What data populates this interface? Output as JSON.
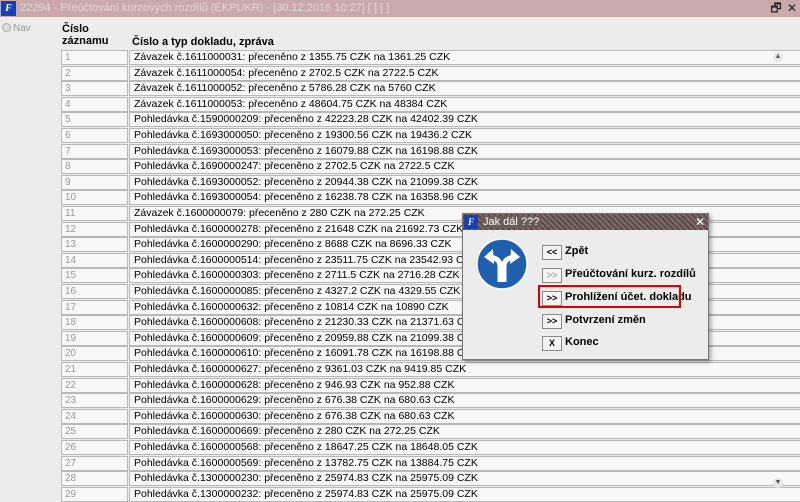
{
  "window": {
    "title": "22294 - Přeúčtování kurzových rozdílů (EKPUKR) - [30.12.2016 10:27] [ ] [ ]",
    "app_icon": "F",
    "restore_label": "🗗",
    "close_label": "✕"
  },
  "nav": {
    "label": "Nav"
  },
  "table": {
    "col1_header_line1": "Číslo",
    "col1_header_line2": "záznamu",
    "col2_header": "Číslo a typ dokladu, zpráva",
    "rows": [
      {
        "no": "1",
        "msg": "Závazek č.1611000031: přeceněno z 1355.75 CZK na 1361.25 CZK"
      },
      {
        "no": "2",
        "msg": "Závazek č.1611000054: přeceněno z 2702.5 CZK na 2722.5 CZK"
      },
      {
        "no": "3",
        "msg": "Závazek č.1611000052: přeceněno z 5786.28 CZK na 5760 CZK"
      },
      {
        "no": "4",
        "msg": "Závazek č.1611000053: přeceněno z 48604.75 CZK na 48384 CZK"
      },
      {
        "no": "5",
        "msg": "Pohledávka č.1590000209: přeceněno z 42223.28 CZK na 42402.39 CZK"
      },
      {
        "no": "6",
        "msg": "Pohledávka č.1693000050: přeceněno z 19300.56 CZK na 19436.2 CZK"
      },
      {
        "no": "7",
        "msg": "Pohledávka č.1693000053: přeceněno z 16079.88 CZK na 16198.88 CZK"
      },
      {
        "no": "8",
        "msg": "Pohledávka č.1690000247: přeceněno z 2702.5 CZK na 2722.5 CZK"
      },
      {
        "no": "9",
        "msg": "Pohledávka č.1693000052: přeceněno z 20944.38 CZK na 21099.38 CZK"
      },
      {
        "no": "10",
        "msg": "Pohledávka č.1693000054: přeceněno z 16238.78 CZK na 16358.96 CZK"
      },
      {
        "no": "11",
        "msg": "Závazek č.1600000079: přeceněno z 280 CZK na 272.25 CZK"
      },
      {
        "no": "12",
        "msg": "Pohledávka č.1600000278: přeceněno z 21648 CZK na 21692.73 CZK"
      },
      {
        "no": "13",
        "msg": "Pohledávka č.1600000290: přeceněno z 8688 CZK na 8696.33 CZK"
      },
      {
        "no": "14",
        "msg": "Pohledávka č.1600000514: přeceněno z 23511.75 CZK na 23542.93 CZK"
      },
      {
        "no": "15",
        "msg": "Pohledávka č.1600000303: přeceněno z 2711.5 CZK na 2716.28 CZK"
      },
      {
        "no": "16",
        "msg": "Pohledávka č.1600000085: přeceněno z 4327.2 CZK na 4329.55 CZK"
      },
      {
        "no": "17",
        "msg": "Pohledávka č.1600000632: přeceněno z 10814 CZK na 10890 CZK"
      },
      {
        "no": "18",
        "msg": "Pohledávka č.1600000608: přeceněno z 21230.33 CZK na 21371.63 CZK"
      },
      {
        "no": "19",
        "msg": "Pohledávka č.1600000609: přeceněno z 20959.88 CZK na 21099.38 CZK"
      },
      {
        "no": "20",
        "msg": "Pohledávka č.1600000610: přeceněno z 16091.78 CZK na 16198.88 CZK"
      },
      {
        "no": "21",
        "msg": "Pohledávka č.1600000627: přeceněno z 9361.03 CZK na 9419.85 CZK"
      },
      {
        "no": "22",
        "msg": "Pohledávka č.1600000628: přeceněno z 946.93 CZK na 952.88 CZK"
      },
      {
        "no": "23",
        "msg": "Pohledávka č.1600000629: přeceněno z 676.38 CZK na 680.63 CZK"
      },
      {
        "no": "24",
        "msg": "Pohledávka č.1600000630: přeceněno z 676.38 CZK na 680.63 CZK"
      },
      {
        "no": "25",
        "msg": "Pohledávka č.1600000669: přeceněno z 280 CZK na 272.25 CZK"
      },
      {
        "no": "26",
        "msg": "Pohledávka č.1600000568: přeceněno z 18647.25 CZK na 18648.05 CZK"
      },
      {
        "no": "27",
        "msg": "Pohledávka č.1600000569: přeceněno z 13782.75 CZK na 13884.75 CZK"
      },
      {
        "no": "28",
        "msg": "Pohledávka č.1300000230: přeceněno z 25974.83 CZK na 25975.09 CZK"
      },
      {
        "no": "29",
        "msg": "Pohledávka č.1300000232: přeceněno z 25974.83 CZK na 25975.09 CZK"
      }
    ]
  },
  "dialog": {
    "title": "Jak dál ???",
    "icon": "F",
    "close_label": "✕",
    "sign_icon": "direction-sign-icon",
    "options": [
      {
        "btn": "<<",
        "label": "Zpět"
      },
      {
        "btn": ">>",
        "label": "Přeúčtování kurz. rozdílů"
      },
      {
        "btn": ">>",
        "label": "Prohlížení účet. dokladu"
      },
      {
        "btn": ">>",
        "label": "Potvrzení změn"
      },
      {
        "btn": "X",
        "label": "Konec"
      }
    ],
    "highlight_color": "#e00000"
  },
  "colors": {
    "titlebar": "#c9a9a9",
    "sign_blue": "#1f5fb0"
  }
}
